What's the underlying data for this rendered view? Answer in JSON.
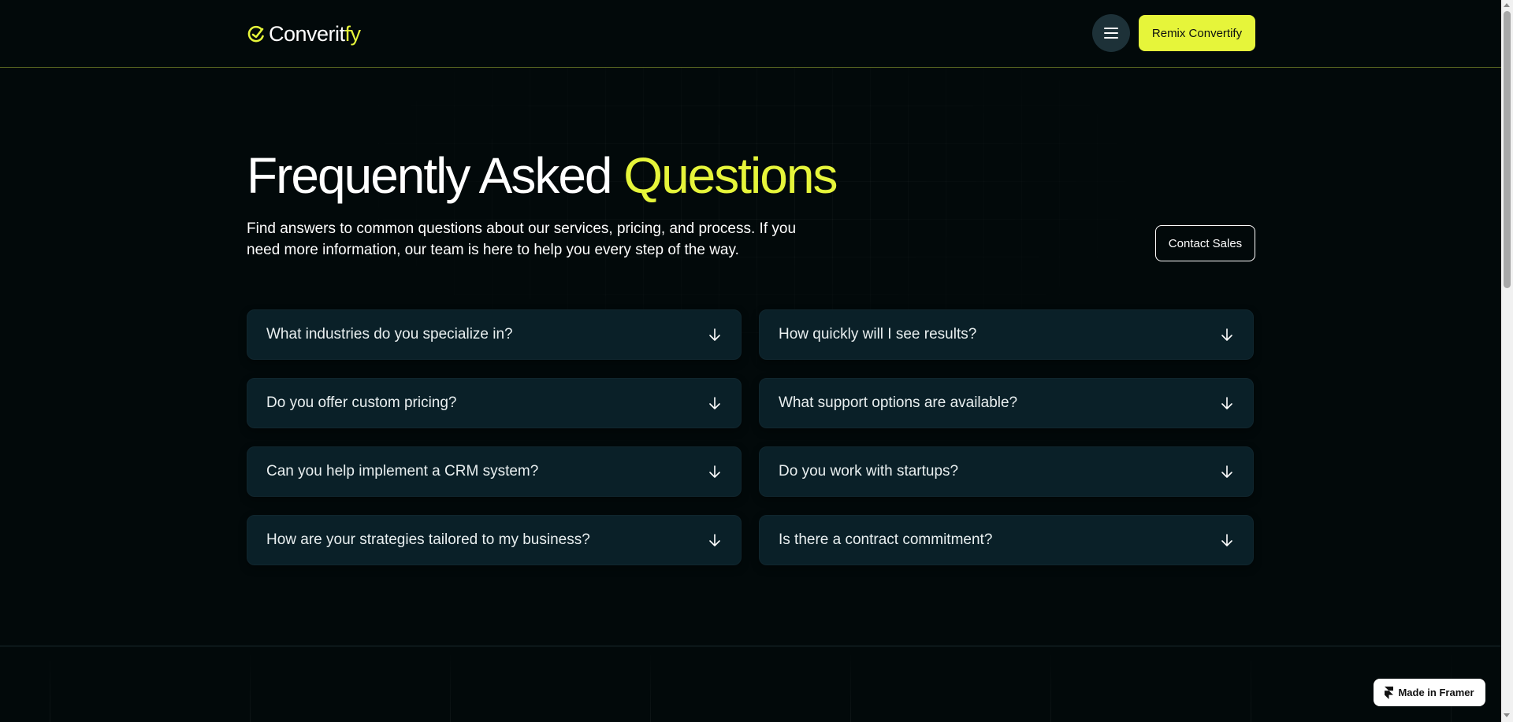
{
  "header": {
    "logo_text": "Converit",
    "logo_accent": "fy",
    "menu_icon": "hamburger-menu-icon",
    "remix_label": "Remix Convertify"
  },
  "hero": {
    "title_main": "Frequently Asked ",
    "title_accent": "Questions",
    "subtitle": "Find answers to common questions about our services, pricing, and process. If you need more information, our team is here to help you every step of the way.",
    "contact_label": "Contact Sales"
  },
  "faq": [
    {
      "question": "What industries do you specialize in?"
    },
    {
      "question": "How quickly will I see results?"
    },
    {
      "question": "Do you offer custom pricing?"
    },
    {
      "question": "What support options are available?"
    },
    {
      "question": "Can you help implement a CRM system?"
    },
    {
      "question": "Do you work with startups?"
    },
    {
      "question": "How are your strategies tailored to my business?"
    },
    {
      "question": "Is there a contract commitment?"
    }
  ],
  "badge": {
    "label": "Made in Framer",
    "icon": "framer-logo-icon"
  },
  "colors": {
    "accent": "#e6f53a",
    "background": "#02090a",
    "card": "#0a2028"
  }
}
